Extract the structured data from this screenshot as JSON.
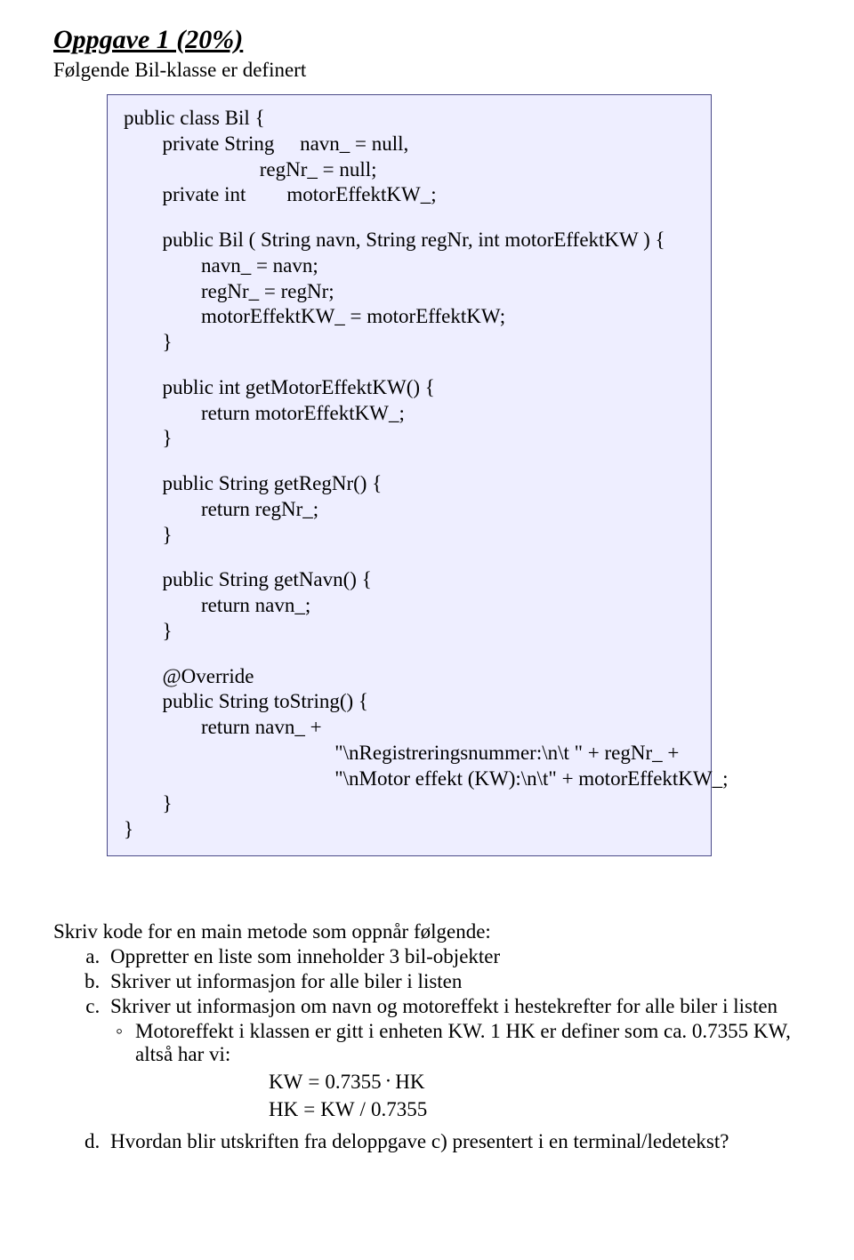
{
  "title": "Oppgave 1 (20%)",
  "subtitle": "Følgende Bil-klasse er definert",
  "code": {
    "l01": "public class Bil {",
    "l02": "  private String     navn_ = null,",
    "l03": "                     regNr_ = null;",
    "l04": "  private int        motorEffektKW_;",
    "l06": "  public Bil ( String navn, String regNr, int motorEffektKW ) {",
    "l07": "    navn_ = navn;",
    "l08": "    regNr_ = regNr;",
    "l09": "    motorEffektKW_ = motorEffektKW;",
    "l10": "  }",
    "l12": "  public int getMotorEffektKW() {",
    "l13": "    return motorEffektKW_;",
    "l14": "  }",
    "l16": "  public String getRegNr() {",
    "l17": "    return regNr_;",
    "l18": "  }",
    "l20": "  public String getNavn() {",
    "l21": "    return navn_;",
    "l22": "  }",
    "l24": "  @Override",
    "l25": "  public String toString() {",
    "l26": "    return navn_ +",
    "l27": "           \"\\nRegistreringsnummer:\\n\\t \" + regNr_ +",
    "l28": "           \"\\nMotor effekt (KW):\\n\\t\" + motorEffektKW_;",
    "l29": "  }",
    "l30": "}"
  },
  "questionIntro": "Skriv kode for en main metode som oppnår følgende:",
  "qa": "Oppretter en liste som inneholder 3 bil-objekter",
  "qb": "Skriver ut informasjon for alle biler i listen",
  "qc": "Skriver ut informasjon om navn og motoreffekt i hestekrefter for alle biler i listen",
  "qc_sub": "Motoreffekt i klassen er gitt i enheten KW. 1 HK er definer som ca. 0.7355 KW, altså har vi:",
  "formulas": {
    "f1_lhs": "KW",
    "f1_eq": "=",
    "f1_r1": "0.7355",
    "f1_dot": "·",
    "f1_r2": "HK",
    "f2_lhs": "HK",
    "f2_eq": "=",
    "f2_r1": "KW",
    "f2_slash": "/",
    "f2_r2": "0.7355"
  },
  "qd": "Hvordan blir utskriften fra deloppgave c) presentert i en terminal/ledetekst?"
}
